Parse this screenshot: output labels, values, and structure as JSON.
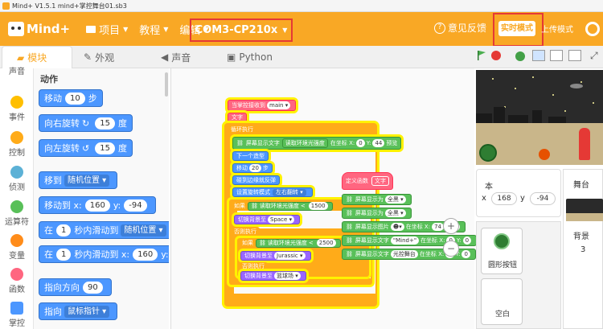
{
  "window": {
    "title": "Mind+ V1.5.1    mind+掌控舞台01.sb3"
  },
  "menubar": {
    "logo": "Mind+",
    "items": [
      {
        "label": "项目"
      },
      {
        "label": "教程"
      },
      {
        "label": "编辑"
      }
    ],
    "port": "COM3-CP210x",
    "feedback": "意见反馈",
    "mode_realtime": "实时模式",
    "mode_upload": "上传模式"
  },
  "tabs": [
    {
      "label": "模块"
    },
    {
      "label": "外观"
    },
    {
      "label": "声音"
    },
    {
      "label": "Python"
    }
  ],
  "categories": [
    {
      "label": "声音",
      "color": "#cf63cf"
    },
    {
      "label": "事件",
      "color": "#ffbf00"
    },
    {
      "label": "控制",
      "color": "#ffab19"
    },
    {
      "label": "侦测",
      "color": "#5cb1d6"
    },
    {
      "label": "运算符",
      "color": "#59c059"
    },
    {
      "label": "变量",
      "color": "#ff8c1a"
    },
    {
      "label": "函数",
      "color": "#ff6680"
    },
    {
      "label": "掌控",
      "color": "#4c97ff"
    }
  ],
  "palette": {
    "section": "动作",
    "move": {
      "pre": "移动",
      "val": "10",
      "post": "步"
    },
    "turn_right": {
      "pre": "向右旋转",
      "val": "15",
      "post": "度"
    },
    "turn_left": {
      "pre": "向左旋转",
      "val": "15",
      "post": "度"
    },
    "goto": {
      "pre": "移到",
      "opt": "随机位置"
    },
    "goto_xy": {
      "pre": "移动到 x:",
      "x": "160",
      "ymid": "y:",
      "y": "-94"
    },
    "glide": {
      "pre": "在",
      "val": "1",
      "mid": "秒内滑动到",
      "opt": "随机位置"
    },
    "glide_xy": {
      "pre": "在",
      "val": "1",
      "mid": "秒内滑动到 x:",
      "x": "160",
      "ymid": "y:"
    },
    "point_dir": {
      "pre": "指向方向",
      "val": "90"
    },
    "point_to": {
      "pre": "指向",
      "opt": "鼠标指针"
    }
  },
  "script": {
    "hat": "当掌控接收到",
    "hat_opt": "main",
    "text": "文字",
    "loop": "循环执行",
    "show1_a": "屏幕显示文字",
    "show1_b": "读取环境光强度",
    "show1_c": "在坐标 X:",
    "show1_x": "0",
    "show1_y": "44",
    "show1_d": "预览",
    "next": "下一个造型",
    "move": "移动",
    "move_v": "20",
    "move_u": "步",
    "bounce": "碰到边缘就反弹",
    "rot": "设置旋转模式",
    "rot_v": "左右翻转",
    "if1": "如果",
    "if1_b": "读取环境光强度",
    "if1_v": "1500",
    "bg1": "切换背景至",
    "bg1_v": "Space",
    "else1": "否则执行",
    "if2": "如果",
    "if2_b": "读取环境光强度",
    "if2_v": "2500",
    "bg2": "切换背景至",
    "bg2_v": "Jurassic",
    "else2": "否则执行",
    "bg3": "切换背景至",
    "bg3_v": "篮球场",
    "fn_def": "定义函数",
    "fn_name": "文字",
    "fill1": "屏幕显示为",
    "fill1_v": "全黑",
    "fill2": "屏幕显示为",
    "fill2_v": "全黑",
    "img": "屏幕显示图片",
    "img_x": "74",
    "img_y": "1",
    "txt1": "屏幕显示文字",
    "txt1_v": "\"Mind+\"",
    "txt1_x": "0",
    "txt1_y": "0",
    "txt2": "屏幕显示文字",
    "txt2_v": "光控舞台",
    "txt2_x": "0",
    "txt2_y": "0"
  },
  "sprite": {
    "name_label": "本",
    "x_label": "x",
    "x": "168",
    "y_label": "y",
    "y": "-94"
  },
  "sprites": [
    {
      "label": "圆形按钮"
    },
    {
      "label": "空白"
    }
  ],
  "stage_panel": {
    "title": "舞台",
    "bg_label": "背景",
    "bg_count": "3"
  },
  "zoom": {
    "in": "+",
    "out": "−"
  }
}
